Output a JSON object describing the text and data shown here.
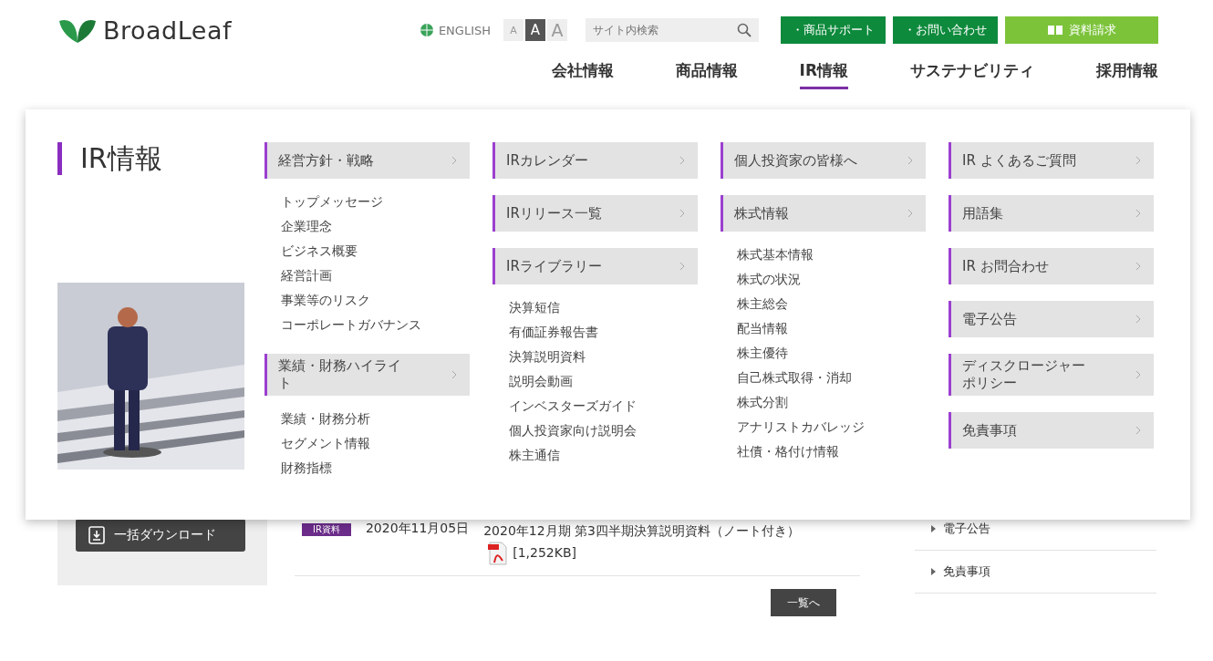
{
  "header": {
    "logo": "BroadLeaf",
    "language": "ENGLISH",
    "font_sizes": [
      {
        "label": "A",
        "selected": false
      },
      {
        "label": "A",
        "selected": true
      },
      {
        "label": "A",
        "selected": false
      }
    ],
    "search": {
      "placeholder": "サイト内検索"
    },
    "buttons": [
      {
        "label": "・商品サポート",
        "kind": "plain",
        "color": "#0e8a3c"
      },
      {
        "label": "・お問い合わせ",
        "kind": "plain",
        "color": "#0e8a3c"
      },
      {
        "label": "資料請求",
        "kind": "book",
        "color": "#7cc33a"
      }
    ]
  },
  "nav": [
    {
      "label": "会社情報",
      "selected": false
    },
    {
      "label": "商品情報",
      "selected": false
    },
    {
      "label": "IR情報",
      "selected": true
    },
    {
      "label": "サステナビリティ",
      "selected": false
    },
    {
      "label": "採用情報",
      "selected": false
    }
  ],
  "mega_menu": {
    "title": "IR情報",
    "picture": {
      "kind": "picture"
    },
    "columns": [
      [
        {
          "label": "経営方針・戦略",
          "links": [
            "トップメッセージ",
            "企業理念",
            "ビジネス概要",
            "経営計画",
            "事業等のリスク",
            "コーポレートガバナンス"
          ]
        },
        {
          "label": "業績・財務ハイライト",
          "links": [
            "業績・財務分析",
            "セグメント情報",
            "財務指標"
          ]
        }
      ],
      [
        {
          "label": "IRカレンダー"
        },
        {
          "label": "IRリリース一覧"
        },
        {
          "label": "IRライブラリー",
          "links": [
            "決算短信",
            "有価証券報告書",
            "決算説明資料",
            "説明会動画",
            "インベスターズガイド",
            "個人投資家向け説明会",
            "株主通信"
          ]
        }
      ],
      [
        {
          "label": "個人投資家の皆様へ"
        },
        {
          "label": "株式情報",
          "links": [
            "株式基本情報",
            "株式の状況",
            "株主総会",
            "配当情報",
            "株主優待",
            "自己株式取得・消却",
            "株式分割",
            "アナリストカバレッジ",
            "社債・格付け情報"
          ]
        }
      ],
      [
        {
          "label": "IR よくあるご質問"
        },
        {
          "label": "用語集"
        },
        {
          "label": "IR お問合わせ"
        },
        {
          "label": "電子公告"
        },
        {
          "label": "ディスクロージャーポリシー"
        },
        {
          "label": "免責事項"
        }
      ]
    ]
  },
  "page": {
    "download_button": "一括ダウンロード",
    "news": [
      {
        "tag": "IR資料",
        "date": "2020年11月05日",
        "title": "2020年12月期 第3四半期決算説明資料（ノート付き）",
        "size": "[1,252KB]"
      }
    ],
    "more_button": "一覧へ",
    "sidebar_links": [
      "電子公告",
      "免責事項"
    ]
  }
}
